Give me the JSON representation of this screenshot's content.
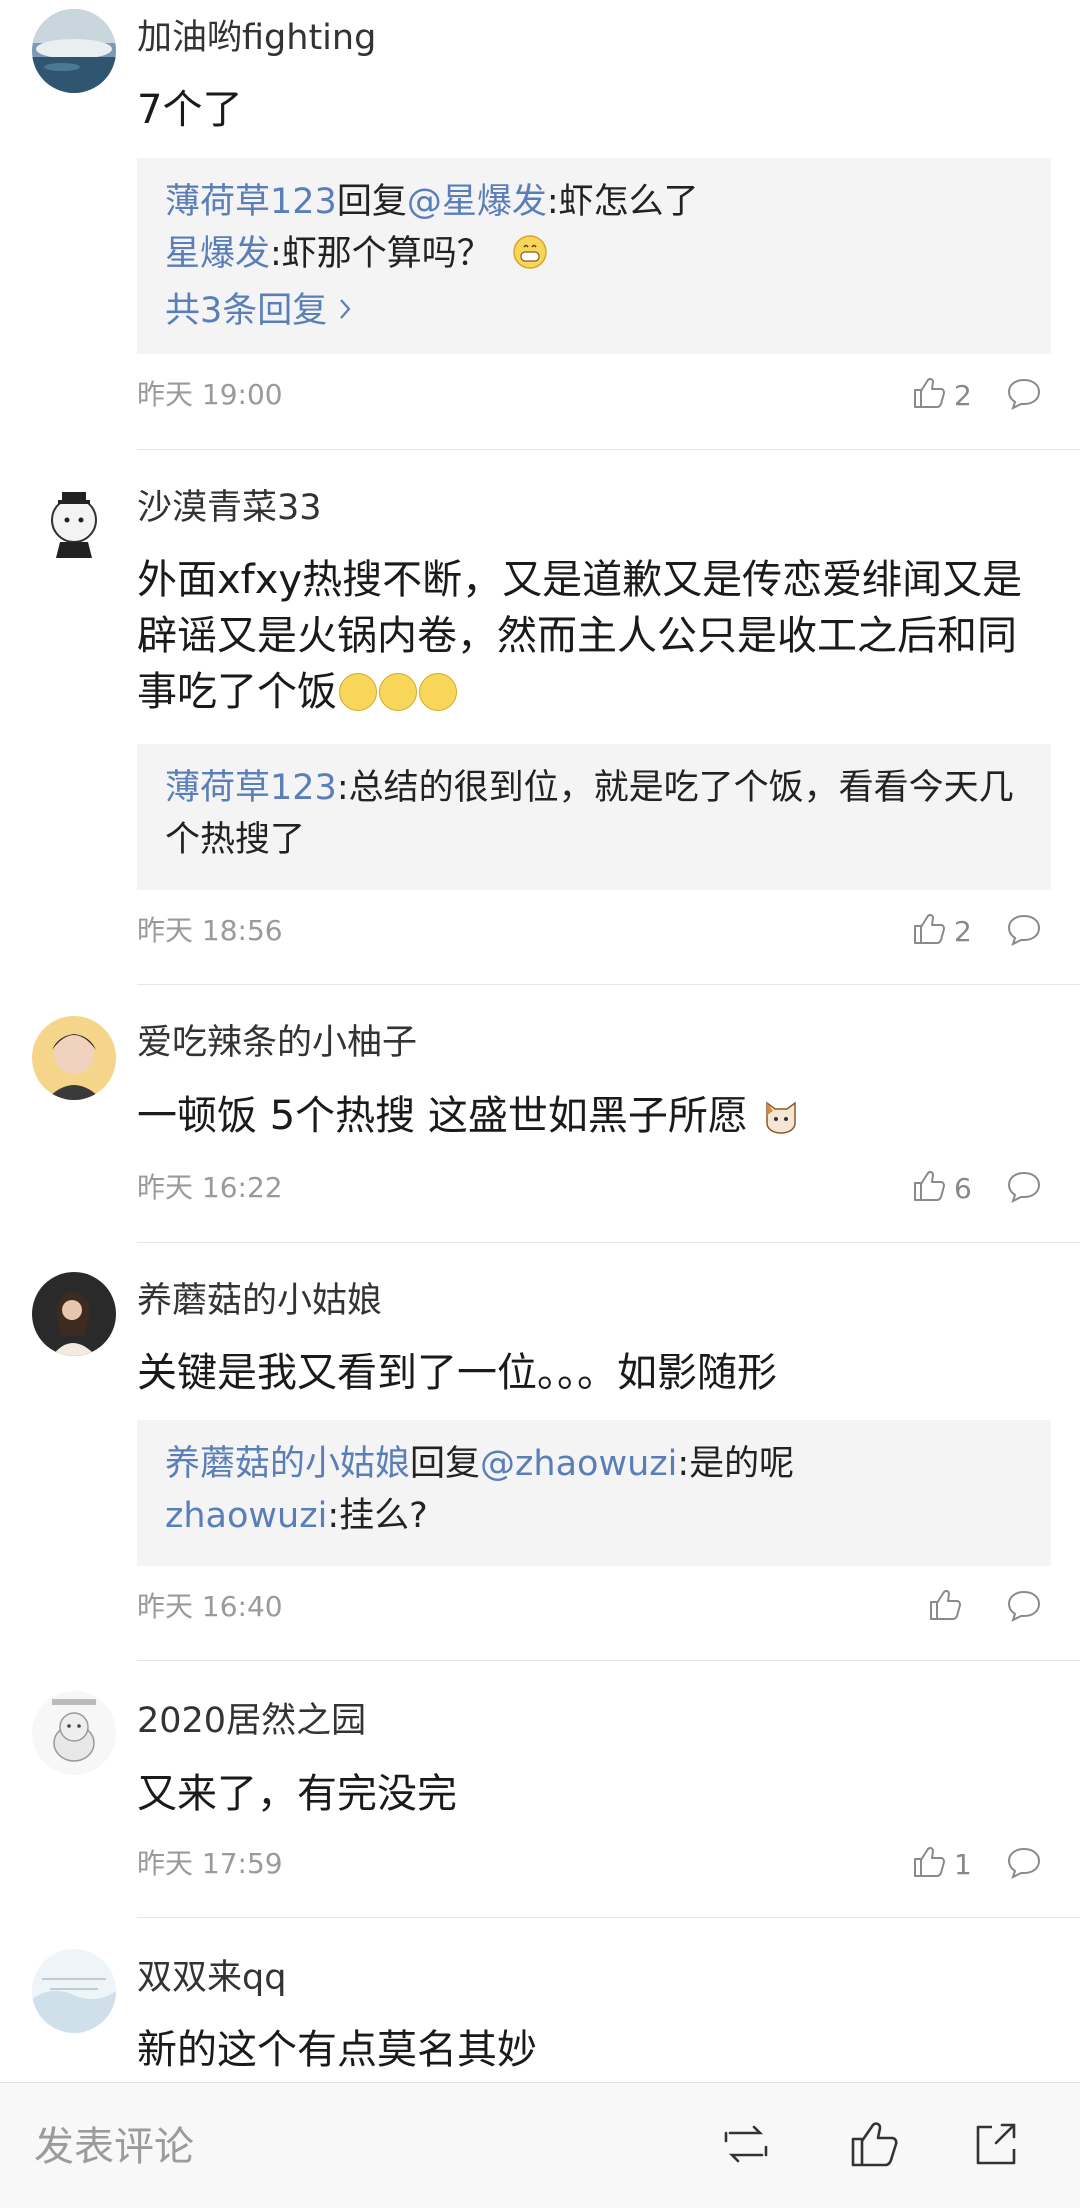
{
  "comments": [
    {
      "username": "加油哟fighting",
      "text": "7个了",
      "replies": [
        {
          "name": "薄荷草123",
          "mid": "回复",
          "target": "@星爆发",
          "text": ":虾怎么了"
        },
        {
          "name": "星爆发",
          "mid": "",
          "target": "",
          "text": ":虾那个算吗？"
        }
      ],
      "more_label": "共3条回复",
      "time": "昨天 19:00",
      "likes": "2"
    },
    {
      "username": "沙漠青菜33",
      "text": "外面xfxy热搜不断，又是道歉又是传恋爱绯闻又是辟谣又是火锅内卷，然而主人公只是收工之后和同事吃了个饭",
      "replies": [
        {
          "name": "薄荷草123",
          "text": ":总结的很到位，就是吃了个饭，看看今天几个热搜了"
        }
      ],
      "time": "昨天 18:56",
      "likes": "2"
    },
    {
      "username": "爱吃辣条的小柚子",
      "text": "一顿饭 5个热搜 这盛世如黑子所愿",
      "time": "昨天 16:22",
      "likes": "6"
    },
    {
      "username": "养蘑菇的小姑娘",
      "text": "关键是我又看到了一位。。。如影随形",
      "replies": [
        {
          "name": "养蘑菇的小姑娘",
          "mid": "回复",
          "target": "@zhaowuzi",
          "text": ":是的呢"
        },
        {
          "name": "zhaowuzi",
          "text": ":挂么?"
        }
      ],
      "time": "昨天 16:40",
      "likes": ""
    },
    {
      "username": "2020居然之园",
      "text": "又来了，有完没完",
      "time": "昨天 17:59",
      "likes": "1"
    },
    {
      "username": "双双来qq",
      "text": "新的这个有点莫名其妙"
    }
  ],
  "bottom_bar": {
    "placeholder": "发表评论",
    "icons": [
      "repost-icon",
      "like-icon",
      "share-icon"
    ]
  },
  "colors": {
    "link": "#5a7fb8",
    "reply_bg": "#f4f4f4",
    "meta": "#9a9a9a"
  }
}
